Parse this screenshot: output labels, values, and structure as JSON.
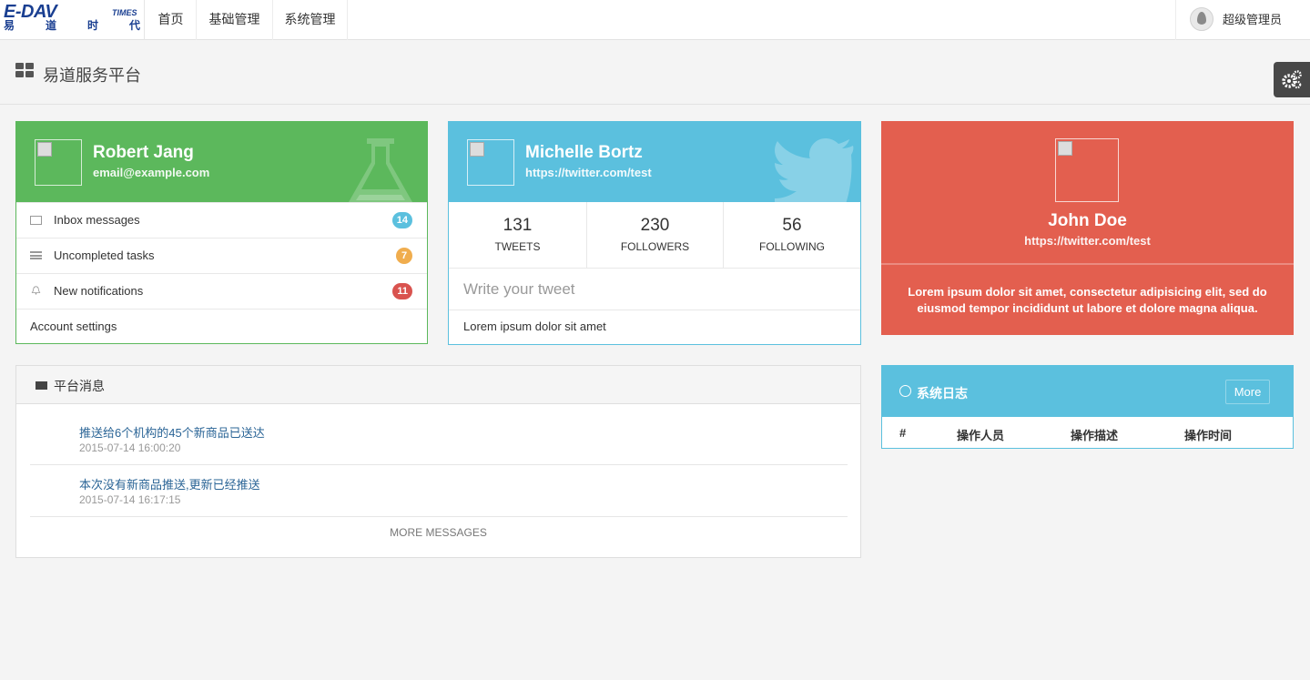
{
  "nav": {
    "logo_text": "E-DAV",
    "logo_times": "TIMES",
    "logo_chars": [
      "易",
      "道",
      "时",
      "代"
    ],
    "items": [
      {
        "label": "首页"
      },
      {
        "label": "基础管理"
      },
      {
        "label": "系统管理"
      }
    ],
    "user_name": "超级管理员"
  },
  "header": {
    "title": "易道服务平台"
  },
  "profile_card": {
    "name": "Robert Jang",
    "email": "email@example.com",
    "accent": "#5cb85c",
    "rows": [
      {
        "label": "Inbox messages",
        "badge": "14",
        "badge_color": "#5bc0de",
        "icon": "envelope-icon"
      },
      {
        "label": "Uncompleted tasks",
        "badge": "7",
        "badge_color": "#f0ad4e",
        "icon": "tasks-icon"
      },
      {
        "label": "New notifications",
        "badge": "11",
        "badge_color": "#d9534f",
        "icon": "bell-icon"
      },
      {
        "label": "Account settings"
      }
    ]
  },
  "twitter_card": {
    "name": "Michelle Bortz",
    "link": "https://twitter.com/test",
    "accent": "#5bc0de",
    "stats": [
      {
        "value": "131",
        "label": "TWEETS"
      },
      {
        "value": "230",
        "label": "FOLLOWERS"
      },
      {
        "value": "56",
        "label": "FOLLOWING"
      }
    ],
    "tweet_placeholder": "Write your tweet",
    "tweet_text": "Lorem ipsum dolor sit amet"
  },
  "red_card": {
    "name": "John Doe",
    "link": "https://twitter.com/test",
    "accent": "#e35f4f",
    "description": "Lorem ipsum dolor sit amet, consectetur adipisicing elit, sed do eiusmod tempor incididunt ut labore et dolore magna aliqua."
  },
  "messages": {
    "title": "平台消息",
    "items": [
      {
        "text": "推送给6个机构的45个新商品已送达",
        "time": "2015-07-14 16:00:20"
      },
      {
        "text": "本次没有新商品推送,更新已经推送",
        "time": "2015-07-14 16:17:15"
      }
    ],
    "more_label": "MORE MESSAGES"
  },
  "log": {
    "title": "系统日志",
    "more_label": "More",
    "columns": [
      "#",
      "操作人员",
      "操作描述",
      "操作时间"
    ]
  }
}
